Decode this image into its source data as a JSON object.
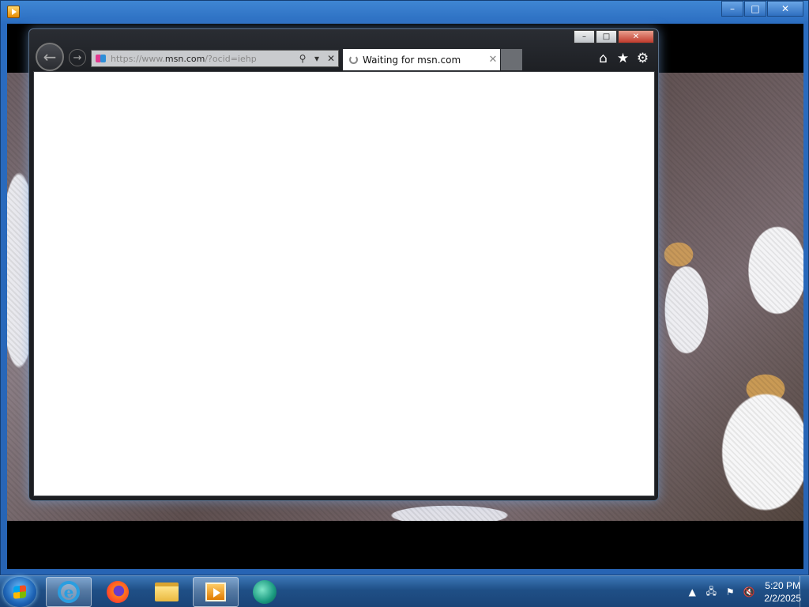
{
  "outer_window": {
    "icon": "media-player-icon",
    "controls": {
      "minimize": "–",
      "maximize": "□",
      "close": "✕"
    }
  },
  "browser": {
    "controls": {
      "minimize": "–",
      "maximize": "□",
      "close": "✕"
    },
    "back_glyph": "←",
    "forward_glyph": "→",
    "address": {
      "prefix": "https://www.",
      "domain": "msn.com",
      "suffix": "/?ocid=iehp",
      "search_glyph": "⚲",
      "dropdown_glyph": "▾",
      "stop_glyph": "✕"
    },
    "tab": {
      "label": "Waiting for msn.com",
      "close_glyph": "✕"
    },
    "tools": {
      "home": "⌂",
      "favorites": "★",
      "settings": "⚙"
    }
  },
  "taskbar": {
    "items": [
      "internet-explorer",
      "firefox",
      "file-explorer",
      "media-player",
      "app"
    ],
    "tray": {
      "overflow": "▲",
      "network": "🖧",
      "flag": "⚑",
      "volume": "🔇"
    },
    "clock": {
      "time": "5:20 PM",
      "date": "2/2/2025"
    }
  },
  "colors": {
    "taskbar": "#1f4f86",
    "window_frame": "#2a6cc0",
    "ie_chrome": "#1c1e22",
    "close_red": "#c0392b"
  }
}
